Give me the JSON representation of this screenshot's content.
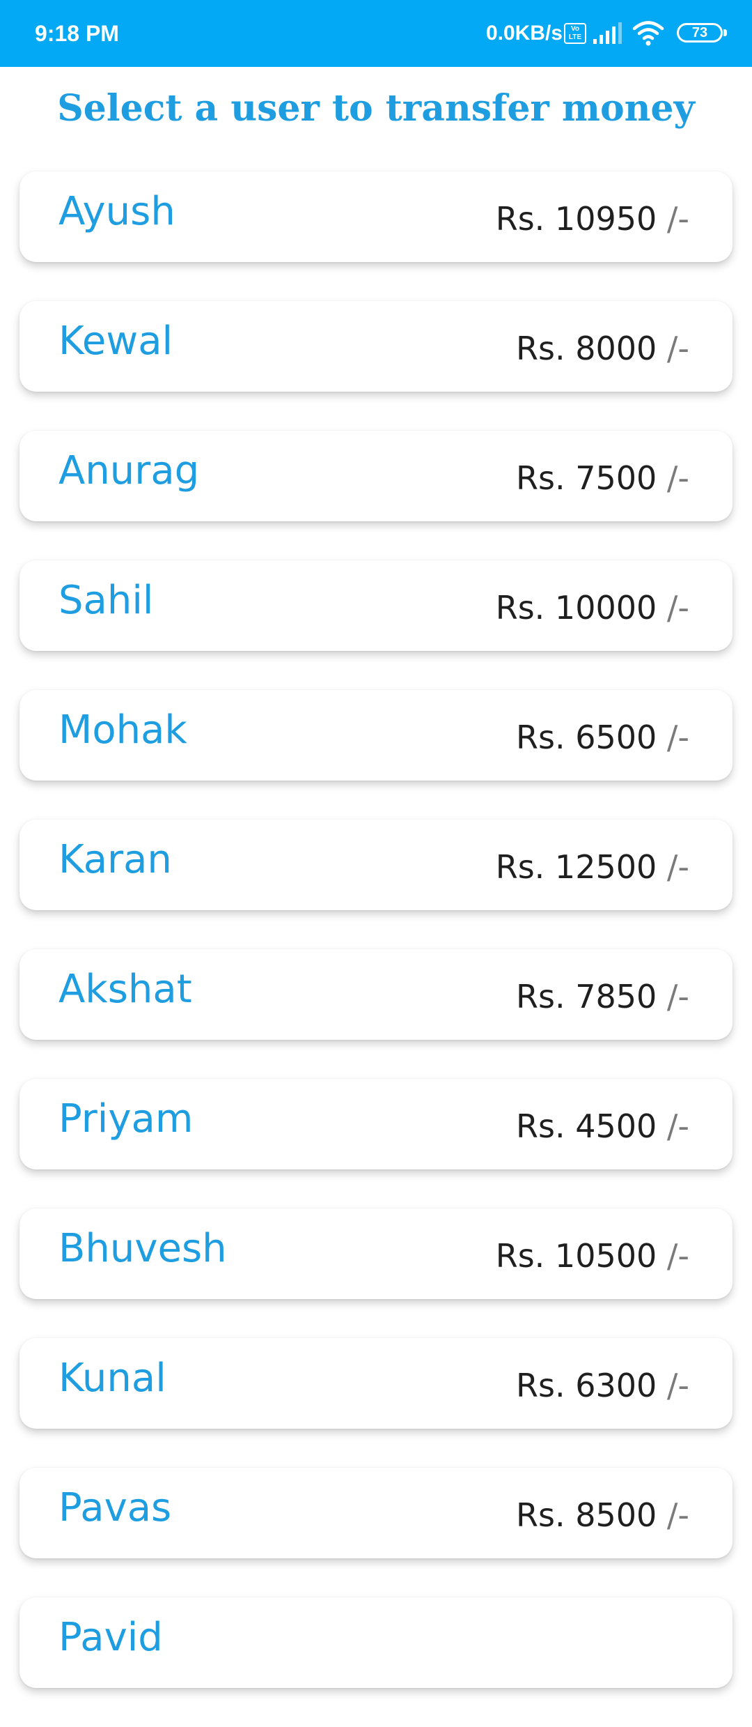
{
  "status_bar": {
    "time": "9:18 PM",
    "net_speed": "0.0KB/s",
    "volte_label": "Vo LTE",
    "battery_level": "73"
  },
  "page": {
    "title": "Select a user to transfer money"
  },
  "users": [
    {
      "name": "Ayush",
      "balance": "Rs. 10950",
      "suffix": "/-"
    },
    {
      "name": "Kewal",
      "balance": "Rs. 8000",
      "suffix": "/-"
    },
    {
      "name": "Anurag",
      "balance": "Rs. 7500",
      "suffix": "/-"
    },
    {
      "name": "Sahil",
      "balance": "Rs. 10000",
      "suffix": "/-"
    },
    {
      "name": "Mohak",
      "balance": "Rs. 6500",
      "suffix": "/-"
    },
    {
      "name": "Karan",
      "balance": "Rs. 12500",
      "suffix": "/-"
    },
    {
      "name": "Akshat",
      "balance": "Rs. 7850",
      "suffix": "/-"
    },
    {
      "name": "Priyam",
      "balance": "Rs. 4500",
      "suffix": "/-"
    },
    {
      "name": "Bhuvesh",
      "balance": "Rs. 10500",
      "suffix": "/-"
    },
    {
      "name": "Kunal",
      "balance": "Rs. 6300",
      "suffix": "/-"
    },
    {
      "name": "Pavas",
      "balance": "Rs. 8500",
      "suffix": "/-"
    },
    {
      "name": "Pavid",
      "balance": "",
      "suffix": ""
    }
  ],
  "colors": {
    "status_bar": "#03A9F4",
    "accent": "#1E9EE0",
    "balance_text": "#1f1f1f",
    "suffix_text": "#7a7a7a"
  }
}
